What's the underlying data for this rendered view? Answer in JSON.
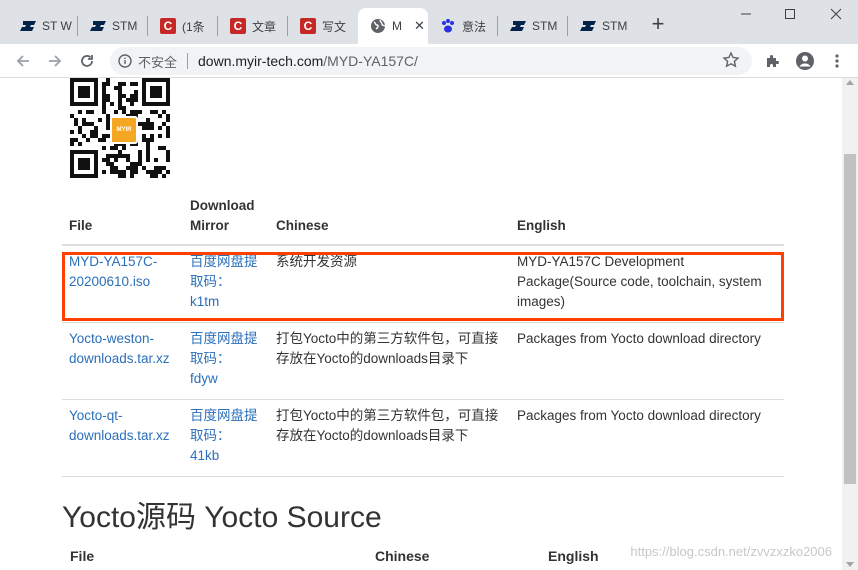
{
  "tabs": [
    {
      "title": "ST W",
      "icon": "st-logo-icon",
      "active": false
    },
    {
      "title": "STM",
      "icon": "st-logo-icon",
      "active": false
    },
    {
      "title": "(1条",
      "icon": "csdn-c-icon",
      "active": false
    },
    {
      "title": "文章",
      "icon": "csdn-c-icon",
      "active": false
    },
    {
      "title": "写文",
      "icon": "csdn-c-icon",
      "active": false
    },
    {
      "title": "M",
      "icon": "globe-icon",
      "active": true
    },
    {
      "title": "意法",
      "icon": "baidu-paw-icon",
      "active": false
    },
    {
      "title": "STM",
      "icon": "st-logo-icon",
      "active": false
    },
    {
      "title": "STM",
      "icon": "st-logo-icon",
      "active": false
    }
  ],
  "address": {
    "security_label": "不安全",
    "host": "down.myir-tech.com",
    "path": "/MYD-YA157C/"
  },
  "qr_logo_text": "MYIR",
  "file_table": {
    "headers": {
      "file": "File",
      "mirror_line1": "Download",
      "mirror_line2": "Mirror",
      "chinese": "Chinese",
      "english": "English"
    },
    "rows": [
      {
        "file_line1": "MYD-YA157C-",
        "file_line2": "20200610.iso",
        "mirror_line1": "百度网盘提",
        "mirror_line2": "取码：",
        "mirror_line3": "k1tm",
        "chinese": "系统开发资源",
        "english": "MYD-YA157C Development Package(Source code, toolchain, system images)"
      },
      {
        "file_line1": "Yocto-weston-",
        "file_line2": "downloads.tar.xz",
        "mirror_line1": "百度网盘提",
        "mirror_line2": "取码：",
        "mirror_line3": "fdyw",
        "chinese": "打包Yocto中的第三方软件包，可直接存放在Yocto的downloads目录下",
        "english": "Packages from Yocto download directory"
      },
      {
        "file_line1": "Yocto-qt-",
        "file_line2": "downloads.tar.xz",
        "mirror_line1": "百度网盘提",
        "mirror_line2": "取码：",
        "mirror_line3": "41kb",
        "chinese": "打包Yocto中的第三方软件包，可直接存放在Yocto的downloads目录下",
        "english": "Packages from Yocto download directory"
      }
    ]
  },
  "section": {
    "title": "Yocto源码 Yocto Source",
    "headers": {
      "file": "File",
      "chinese": "Chinese",
      "english": "English"
    }
  },
  "watermark": "https://blog.csdn.net/zvvzxzko2006",
  "colors": {
    "highlight": "#ff4000",
    "link": "#2a6fba",
    "csdn": "#c62828"
  }
}
